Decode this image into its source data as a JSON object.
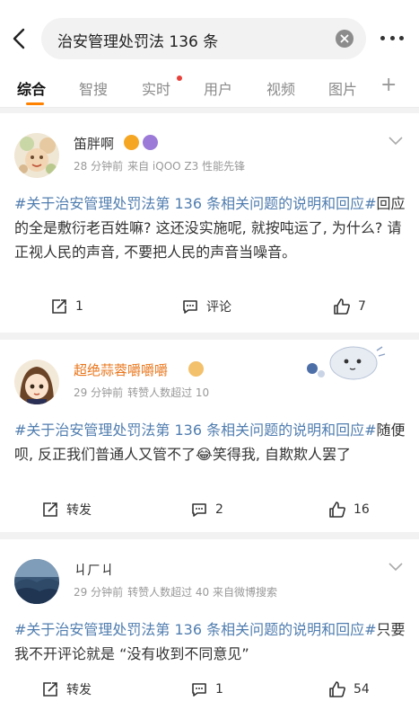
{
  "search": {
    "query": "治安管理处罚法 136 条"
  },
  "tabs": [
    {
      "label": "综合",
      "active": true
    },
    {
      "label": "智搜",
      "active": false
    },
    {
      "label": "实时",
      "active": false,
      "has_dot": true
    },
    {
      "label": "用户",
      "active": false
    },
    {
      "label": "视频",
      "active": false
    },
    {
      "label": "图片",
      "active": false
    }
  ],
  "tab_more": "+",
  "accent_color": "#ff8200",
  "topic_color": "#507daf",
  "posts": [
    {
      "username": "笛胖啊",
      "username_color": "#333333",
      "time": "28 分钟前",
      "source": "来自 iQOO Z3 性能先锋",
      "topic": "#关于治安管理处罚法第 136 条相关问题的说明和回应#",
      "body": "回应的全是敷衍老百姓嘛? 这还没实施呢, 就按吨运了, 为什么? 请正视人民的声音, 不要把人民的声音当噪音。",
      "repost": "1",
      "comment": "评论",
      "like": "7"
    },
    {
      "username": "超绝蒜蓉嚼嚼嚼",
      "username_color": "#e8751a",
      "time": "29 分钟前",
      "source": "转赞人数超过 10",
      "topic": "#关于治安管理处罚法第 136 条相关问题的说明和回应#",
      "body": "随便呗, 反正我们普通人又管不了😂笑得我, 自欺欺人罢了",
      "repost": "转发",
      "comment": "2",
      "like": "16"
    },
    {
      "username": "ㄐㄏㄐ",
      "username_color": "#333333",
      "time": "29 分钟前",
      "source": "转赞人数超过 40  来自微博搜索",
      "topic": "#关于治安管理处罚法第 136 条相关问题的说明和回应#",
      "body": "只要我不开评论就是 “没有收到不同意见”",
      "repost": "转发",
      "comment": "1",
      "like": "54"
    }
  ]
}
